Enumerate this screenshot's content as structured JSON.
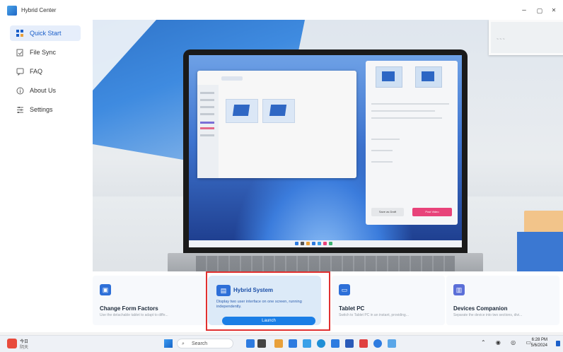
{
  "window": {
    "title": "Hybrid Center",
    "minimize_glyph": "–",
    "maximize_glyph": "▢",
    "close_glyph": "✕"
  },
  "sidebar": {
    "items": [
      {
        "label": "Quick Start",
        "icon": "grid-icon",
        "active": true
      },
      {
        "label": "File Sync",
        "icon": "file-sync-icon",
        "active": false
      },
      {
        "label": "FAQ",
        "icon": "faq-icon",
        "active": false
      },
      {
        "label": "About Us",
        "icon": "info-icon",
        "active": false
      },
      {
        "label": "Settings",
        "icon": "settings-icon",
        "active": false
      }
    ]
  },
  "hero": {
    "laptop_draft_button": "Save as Draft",
    "laptop_post_button": "Post Video"
  },
  "cards": [
    {
      "title": "Change Form Factors",
      "description": "Use the detachable tablet to adapt to diffe...",
      "icon": "form-factor-icon"
    },
    {
      "title": "Hybrid System",
      "description": "Display two user interface on one screen, running independently.",
      "icon": "hybrid-system-icon",
      "button": "Launch",
      "selected": true
    },
    {
      "title": "Tablet PC",
      "description": "Switch to Tablet PC in an instant, providing...",
      "icon": "tablet-icon"
    },
    {
      "title": "Devices Companion",
      "description": "Separate the device into two sections, divi...",
      "icon": "devices-companion-icon"
    }
  ],
  "taskbar": {
    "weather_line1": "今日",
    "weather_line2": "阴天",
    "search_placeholder": "Search",
    "time": "6:28 PM",
    "date": "5/6/2024"
  },
  "colors": {
    "accent": "#1b5fc9",
    "launch_button": "#1a7ee6",
    "highlight_border": "#e03030",
    "post_button": "#e8437a"
  }
}
